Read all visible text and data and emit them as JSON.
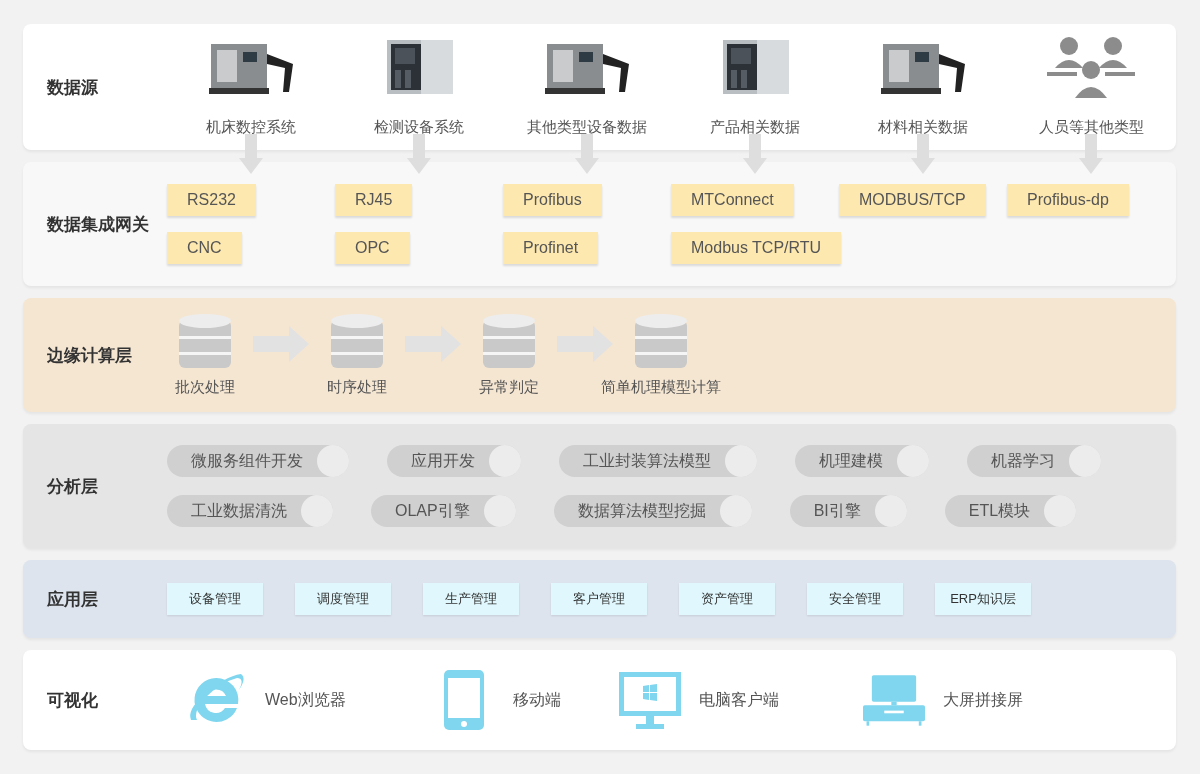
{
  "layers": [
    {
      "kind": "sources",
      "title": "数据源",
      "items": [
        {
          "label": "机床数控系统",
          "kind": "picture"
        },
        {
          "label": "检测设备系统",
          "kind": "picture"
        },
        {
          "label": "其他类型设备数据",
          "kind": "picture"
        },
        {
          "label": "产品相关数据",
          "kind": "picture"
        },
        {
          "label": "材料相关数据",
          "kind": "picture"
        },
        {
          "label": "人员等其他类型",
          "kind": "people"
        }
      ]
    },
    {
      "kind": "gateway",
      "title": "数据集成网关",
      "columns": [
        [
          "RS232",
          "CNC"
        ],
        [
          "RJ45",
          "OPC"
        ],
        [
          "Profibus",
          "Profinet"
        ],
        [
          "MTConnect",
          "Modbus TCP/RTU"
        ],
        [
          "MODBUS/TCP"
        ],
        [
          "Profibus-dp"
        ]
      ]
    },
    {
      "kind": "edge",
      "title": "边缘计算层",
      "steps": [
        "批次处理",
        "时序处理",
        "异常判定",
        "简单机理模型计算"
      ]
    },
    {
      "kind": "analysis",
      "title": "分析层",
      "rows": [
        [
          "微服务组件开发",
          "应用开发",
          "工业封装算法模型",
          "机理建模",
          "机器学习"
        ],
        [
          "工业数据清洗",
          "OLAP引擎",
          "数据算法模型挖掘",
          "BI引擎",
          "ETL模块"
        ]
      ]
    },
    {
      "kind": "apps",
      "title": "应用层",
      "items": [
        "设备管理",
        "调度管理",
        "生产管理",
        "客户管理",
        "资产管理",
        "安全管理",
        "ERP知识层"
      ]
    },
    {
      "kind": "visual",
      "title": "可视化",
      "items": [
        {
          "label": "Web浏览器",
          "kind": "browser"
        },
        {
          "label": "移动端",
          "kind": "phone"
        },
        {
          "label": "电脑客户端",
          "kind": "desktop"
        },
        {
          "label": "大屏拼接屏",
          "kind": "tv"
        }
      ]
    }
  ]
}
